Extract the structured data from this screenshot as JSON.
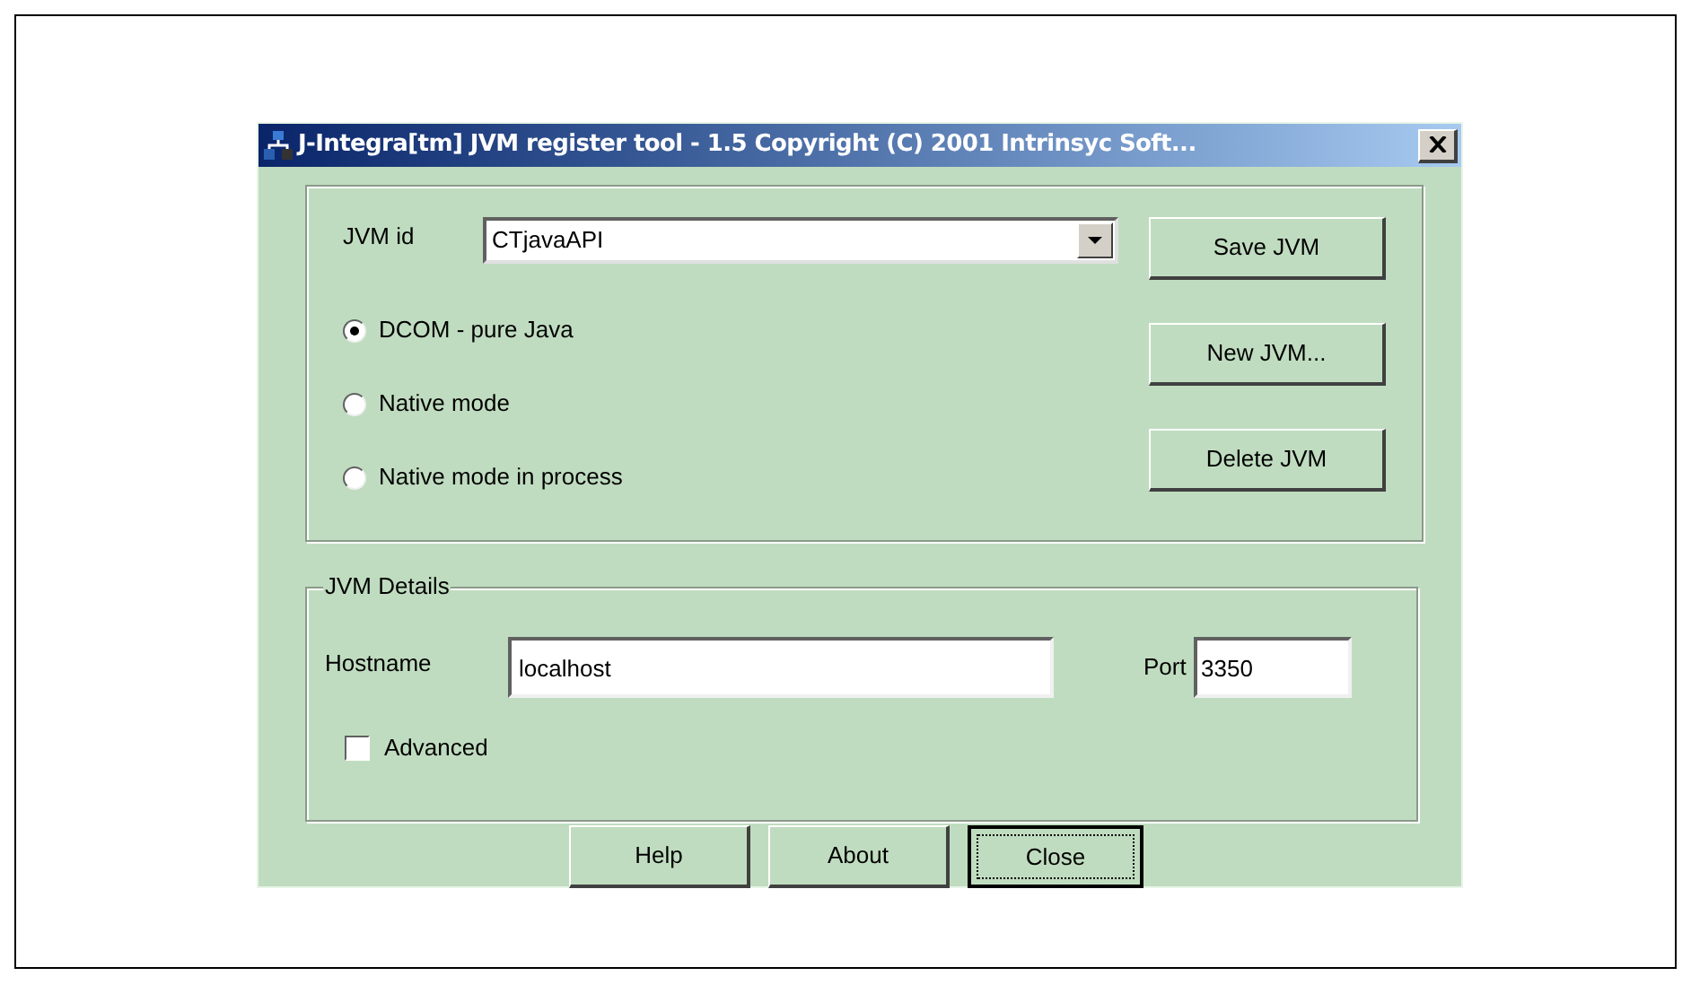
{
  "window": {
    "title": "J-Integra[tm] JVM register tool - 1.5 Copyright (C) 2001 Intrinsyc Soft..."
  },
  "jvm_id": {
    "label": "JVM id",
    "value": "CTjavaAPI"
  },
  "modes": [
    {
      "label": "DCOM - pure Java",
      "selected": true
    },
    {
      "label": "Native mode",
      "selected": false
    },
    {
      "label": "Native mode in process",
      "selected": false
    }
  ],
  "side_buttons": [
    "Save JVM",
    "New JVM...",
    "Delete JVM"
  ],
  "details": {
    "title": "JVM Details",
    "hostname_label": "Hostname",
    "hostname": "localhost",
    "port_label": "Port",
    "port": "3350",
    "advanced": {
      "label": "Advanced",
      "checked": false
    }
  },
  "buttons": [
    {
      "label": "Help",
      "focused": false
    },
    {
      "label": "About",
      "focused": false
    },
    {
      "label": "Close",
      "focused": true
    }
  ]
}
